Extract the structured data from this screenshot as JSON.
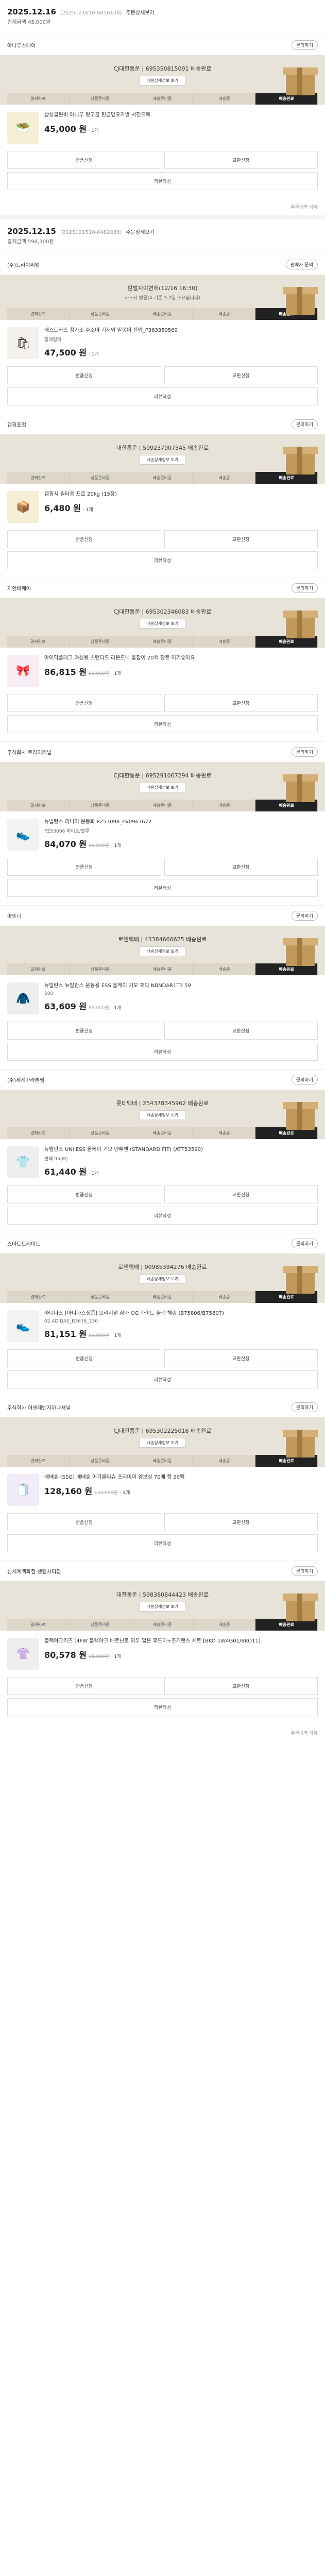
{
  "order1": {
    "date": "2025.12.16",
    "order_no": "(2025121610-0850108)",
    "detail_link": "주문상세보기",
    "total": "결제금액 45,000원"
  },
  "order1_shop": {
    "name": "아니루스테이",
    "cs": "문의하기",
    "carrier": "CJ대한통운 | 695350815091 배송완료",
    "track": "배송상세정보 보기",
    "steps": [
      "결제완료",
      "상품준비중",
      "배송준비중",
      "배송중",
      "배송완료"
    ],
    "item": {
      "name": "삼성클린비 아니루 왕고꿈 헌금덮요가방 서진드북",
      "option": "",
      "price": "45,000 원",
      "list_price": "",
      "qty": "· 1개"
    },
    "actions": [
      "반품신청",
      "교환신청",
      "리뷰작성"
    ]
  },
  "order1_delete": "주문내역 삭제",
  "order2": {
    "date": "2025.12.15",
    "order_no": "(2025121510-0482038)",
    "detail_link": "주문상세보기",
    "total": "결제금액 598,300원"
  },
  "shops": [
    {
      "name": "(주)트라이씨엘",
      "cs": "판매자 문의",
      "carrier": "핀벌지이면허(12/16 16:30)",
      "sub": "카드사 방문(4 기존 3-7일 소요됩니다)",
      "track": "",
      "item": {
        "name": "베스트카즈 청가조 수조마 기저와 밀봉어 진입_P363350569",
        "option": "헝레일마",
        "price": "47,500 원",
        "list_price": "",
        "qty": "· 1개"
      },
      "icon": "🛍",
      "bg": "#f4f1ec"
    },
    {
      "name": "캠핑포럼",
      "cs": "문의하기",
      "carrier": "대한통운 | 599237907545 배송완료",
      "sub": "",
      "track": "배송상세정보 보기",
      "item": {
        "name": "캠핑시 필터용 프로 20kg (15장)",
        "option": "",
        "price": "6,480 원",
        "list_price": "",
        "qty": "· 1개"
      },
      "icon": "📦",
      "bg": "#f6efd5"
    },
    {
      "name": "지엔비웨어",
      "cs": "문의하기",
      "carrier": "CJ대한통운 | 695302346083 배송완료",
      "sub": "",
      "track": "배송상세정보 보기",
      "item": {
        "name": "아이닥플래그 여성용 스탠다드 라운드넥 올잡이 20색 장폰 이기좋아요",
        "option": "",
        "price": "86,815 원",
        "list_price": "99,900원",
        "qty": "· 1개"
      },
      "icon": "🎀",
      "bg": "#f7eef5"
    },
    {
      "name": "주식회사 트라이커널",
      "cs": "문의하기",
      "carrier": "CJ대한통운 | 695291067294 배송완료",
      "sub": "",
      "track": "배송상세정보 보기",
      "item": {
        "name": "뉴발란스 리니어 운동화 PZ53098_FV0967672",
        "option": "PZ53098 화이트/블루",
        "price": "84,070 원",
        "list_price": "99,000원",
        "qty": "· 1개"
      },
      "icon": "👟",
      "bg": "#f2f2f2"
    },
    {
      "name": "마뜨니",
      "cs": "문의하기",
      "carrier": "로젠택배 | 43384666625 배송완료",
      "sub": "",
      "track": "배송상세정보 보기",
      "item": {
        "name": "뉴발란스 뉴발란스 운동용 ESS 올케이 기모 후디 NBNDAR1T3 59",
        "option": "100",
        "price": "63,609 원",
        "list_price": "89,000원",
        "qty": "· 1개"
      },
      "icon": "🧥",
      "bg": "#eeeeee"
    },
    {
      "name": "(주)세계마라톤엠",
      "cs": "문의하기",
      "carrier": "롯데택배 | 254378345962 배송완료",
      "sub": "",
      "track": "배송상세정보 보기",
      "item": {
        "name": "뉴발란스 UNI ESS 올케이 기모 맨투맨 (STANDARD FIT) (ATT53590)",
        "option": "블랙 95(M)",
        "price": "61,440 원",
        "list_price": "",
        "qty": "· 1개"
      },
      "icon": "👕",
      "bg": "#eeeeee"
    },
    {
      "name": "스마트트레이드",
      "cs": "문의하기",
      "carrier": "로젠택배 | 90985394276 배송완료",
      "sub": "",
      "track": "배송상세정보 보기",
      "item": {
        "name": "아디다스 [아디다스정품] 오리지널 삼바 OG 화이트 블랙 헤링 (B75806/B75807)",
        "option": "02.ADIDAS_B3678_230",
        "price": "81,151 원",
        "list_price": "89,000원",
        "qty": "· 1개"
      },
      "icon": "👟",
      "bg": "#f2f2f2"
    },
    {
      "name": "주식회사 어센레벤지아나셔널",
      "cs": "문의하기",
      "carrier": "CJ대한통운 | 695302225016 배송완료",
      "sub": "",
      "track": "배송상세정보 보기",
      "item": {
        "name": "베베숲 (SSG) 베베숲 어기물티슈 프리미어 엠보싱 70매 캡 20팩",
        "option": "",
        "price": "128,160 원",
        "list_price": "144,000원",
        "qty": "· 4개"
      },
      "icon": "🧻",
      "bg": "#f1ecf7"
    },
    {
      "name": "신세계백화점 센텀시티점",
      "cs": "문의하기",
      "carrier": "대한통운 | 598380844423 배송완료",
      "sub": "",
      "track": "배송상세정보 보기",
      "item": {
        "name": "블랙야크키즈 [4FW 블랙야크 베르닌로 외투 얼은 후드티+조거팬츠 세트 [BKO 1W4G01/BKO11]",
        "option": "",
        "price": "80,578 원",
        "list_price": "95,000원",
        "qty": "· 1개"
      },
      "icon": "👚",
      "bg": "#eeeeee"
    }
  ],
  "order2_delete": "주문내역 삭제",
  "common": {
    "steps": [
      "결제완료",
      "상품준비중",
      "배송준비중",
      "배송중",
      "배송완료"
    ],
    "actions": [
      "반품신청",
      "교환신청",
      "리뷰작성"
    ]
  }
}
